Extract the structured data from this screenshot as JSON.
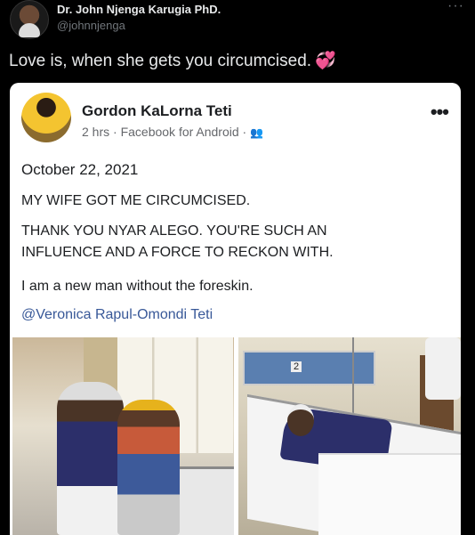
{
  "tweet": {
    "author_name": "Dr. John Njenga Karugia PhD.",
    "author_handle": "@johnnjenga",
    "more_icon": "more-horizontal-icon",
    "text": "Love is, when she gets you circumcised.",
    "emoji_icon": "revolving-hearts-icon"
  },
  "facebook_post": {
    "author": "Gordon KaLorna Teti",
    "meta": "2 hrs · Facebook for Android ·",
    "audience_icon": "friends-icon",
    "lines": [
      "October 22, 2021",
      "MY WIFE GOT ME CIRCUMCISED.",
      "THANK YOU NYAR ALEGO. YOU'RE SUCH AN",
      "INFLUENCE AND A FORCE TO RECKON WITH.",
      "I am a new man without the foreskin."
    ],
    "mention": "@Veronica Rapul-Omondi Teti",
    "photo_right_number": "2"
  },
  "colors": {
    "background": "#000000",
    "link": "#385898",
    "heart": "#e0245e"
  }
}
